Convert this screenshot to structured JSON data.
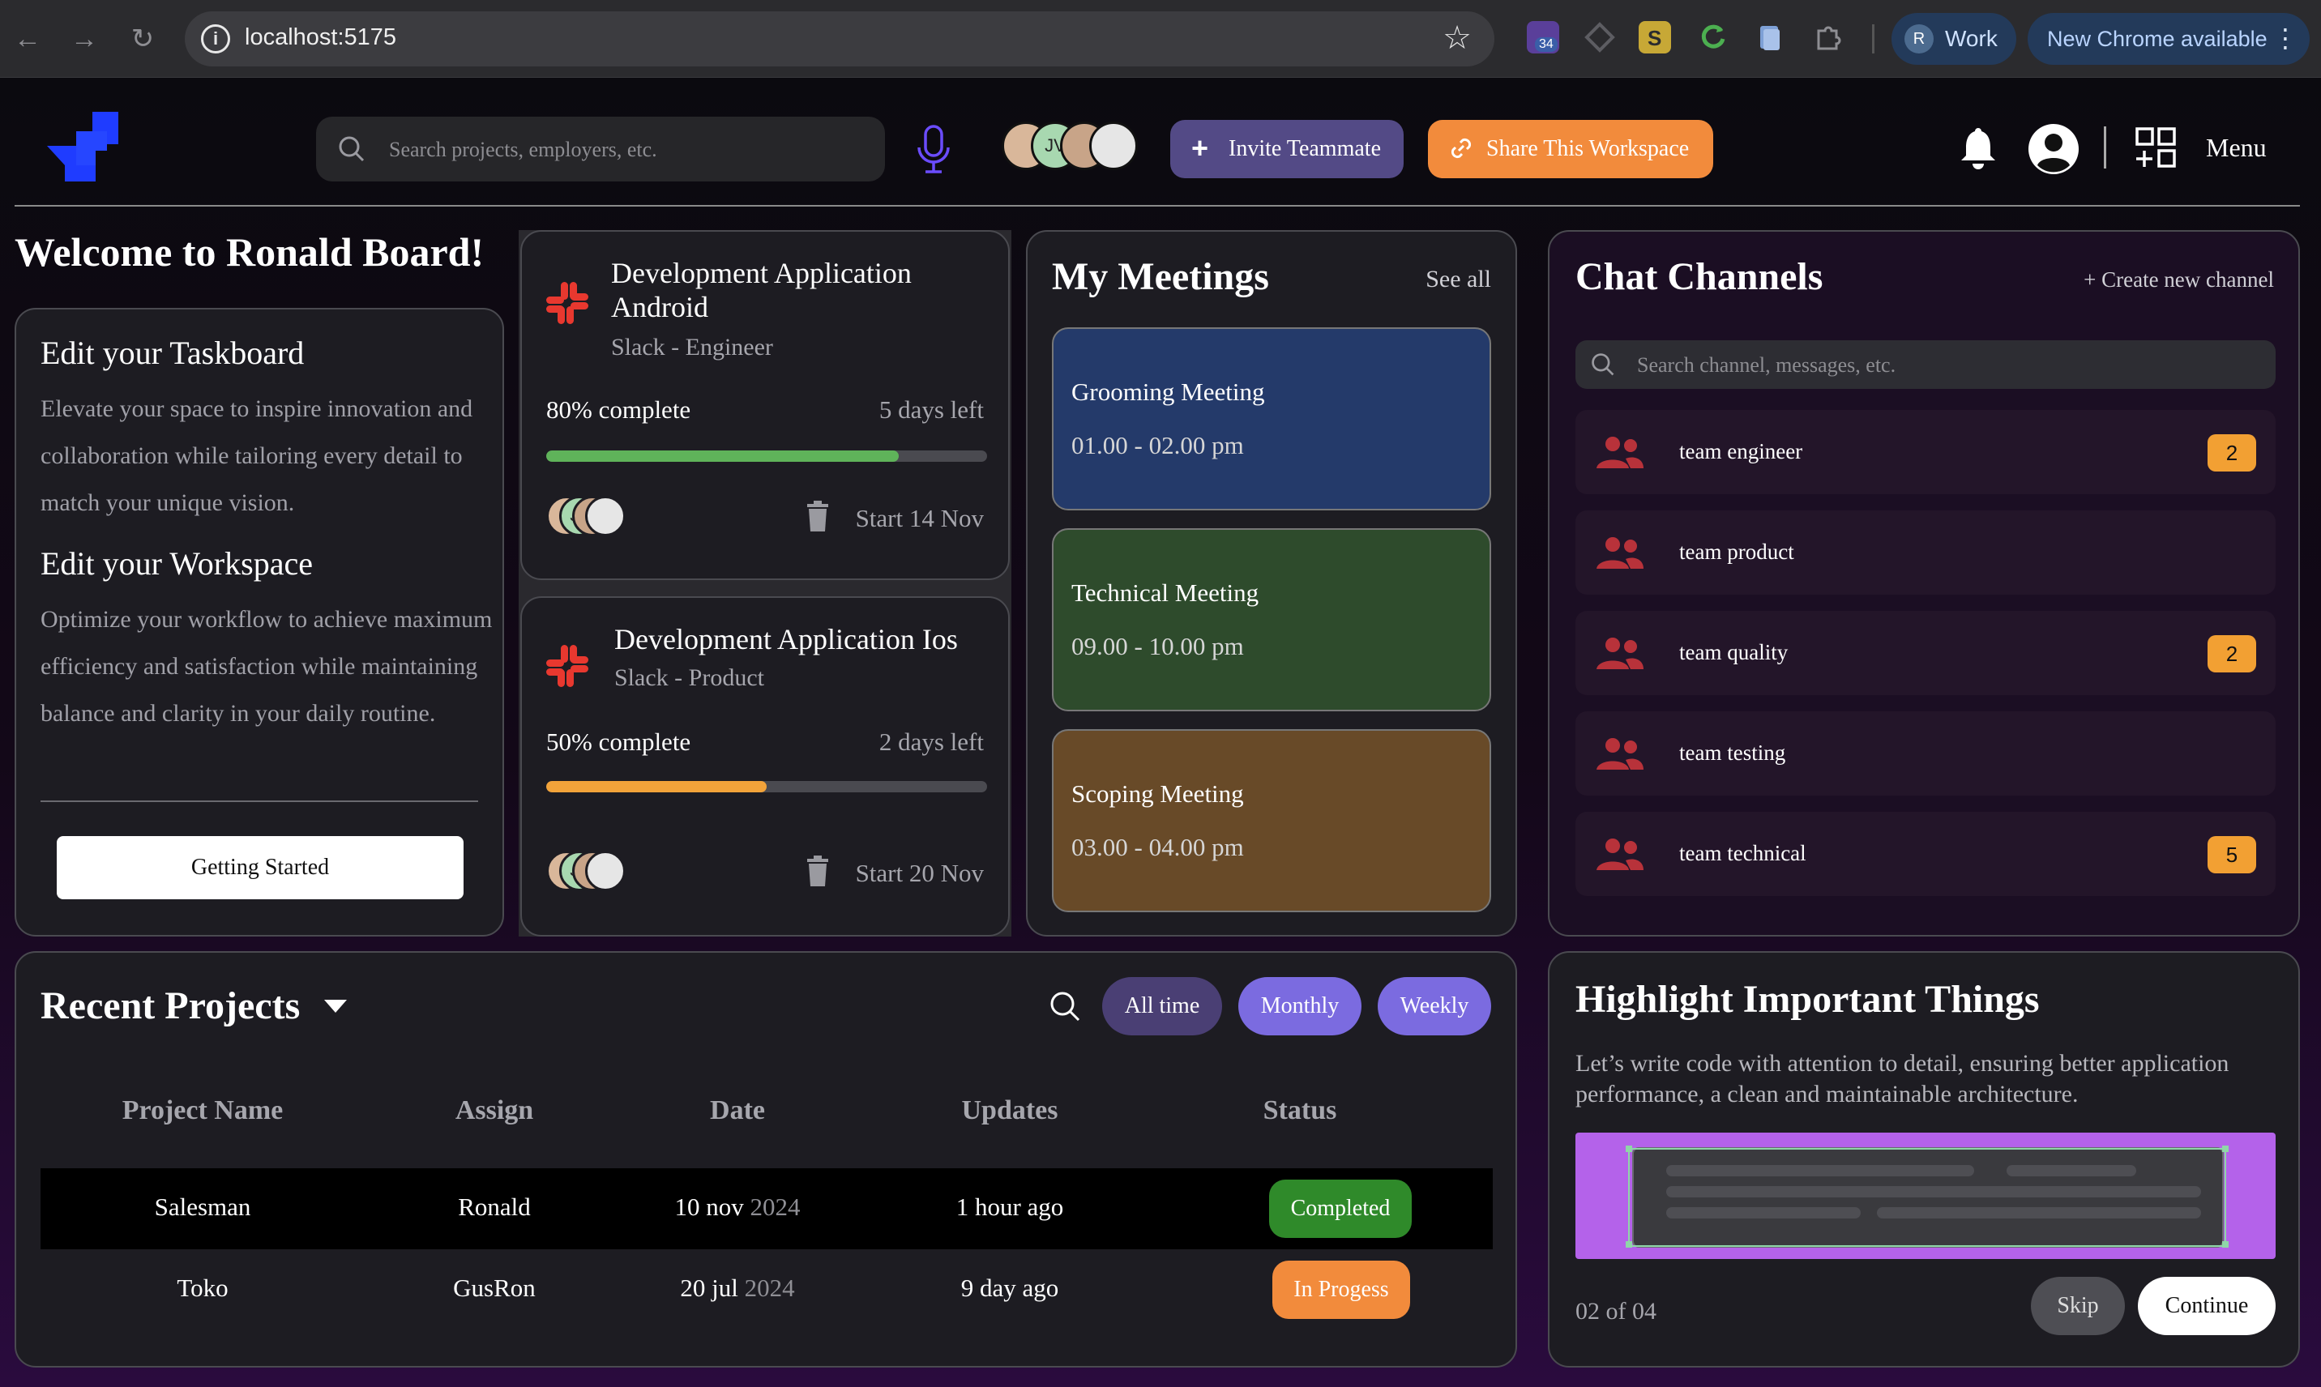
{
  "browser": {
    "url": "localhost:5175",
    "ext_badge": "34",
    "profile_initial": "R",
    "profile_label": "Work",
    "update_label": "New Chrome available"
  },
  "header": {
    "search_placeholder": "Search projects, employers, etc.",
    "avatars": [
      "",
      "JV",
      "",
      ""
    ],
    "invite_label": "Invite Teammate",
    "share_label": "Share This Workspace",
    "menu_label": "Menu"
  },
  "welcome": {
    "title": "Welcome to Ronald Board!",
    "edit_taskboard_title": "Edit your Taskboard",
    "edit_taskboard_text": "Elevate your space to inspire innovation and collaboration while tailoring every detail to match your unique vision.",
    "edit_workspace_title": "Edit your Workspace",
    "edit_workspace_text": "Optimize your workflow to achieve maximum efficiency and satisfaction while maintaining balance and clarity in your daily routine.",
    "getting_started": "Getting Started"
  },
  "tasks": [
    {
      "title": "Development Application Android",
      "subtitle": "Slack - Engineer",
      "progress_label": "80% complete",
      "progress": 0.8,
      "color": "#5fb35a",
      "days_left": "5 days left",
      "start": "Start 14 Nov"
    },
    {
      "title": "Development Application Ios",
      "subtitle": "Slack - Product",
      "progress_label": "50% complete",
      "progress": 0.5,
      "color": "#f2a33a",
      "days_left": "2 days left",
      "start": "Start 20 Nov"
    }
  ],
  "meetings": {
    "title": "My Meetings",
    "see_all": "See all",
    "items": [
      {
        "name": "Grooming Meeting",
        "time": "01.00 - 02.00 pm",
        "color": "#243a6a"
      },
      {
        "name": "Technical Meeting",
        "time": "09.00 - 10.00 pm",
        "color": "#2e4b2c"
      },
      {
        "name": "Scoping Meeting",
        "time": "03.00 - 04.00 pm",
        "color": "#684a28"
      }
    ]
  },
  "chat": {
    "title": "Chat Channels",
    "create": "+ Create new channel",
    "search_placeholder": "Search channel, messages, etc.",
    "channels": [
      {
        "name": "team engineer",
        "badge": "2"
      },
      {
        "name": "team product",
        "badge": ""
      },
      {
        "name": "team quality",
        "badge": "2"
      },
      {
        "name": "team testing",
        "badge": ""
      },
      {
        "name": "team technical",
        "badge": "5"
      }
    ]
  },
  "projects": {
    "title": "Recent Projects",
    "filters": [
      "All time",
      "Monthly",
      "Weekly"
    ],
    "columns": [
      "Project Name",
      "Assign",
      "Date",
      "Updates",
      "Status"
    ],
    "rows": [
      {
        "name": "Salesman",
        "assign": "Ronald",
        "date": "10 nov",
        "year": "2024",
        "updates": "1 hour ago",
        "status": "Completed",
        "status_color": "#2f8a2a"
      },
      {
        "name": "Toko",
        "assign": "GusRon",
        "date": "20 jul",
        "year": "2024",
        "updates": "9 day ago",
        "status": "In Progess",
        "status_color": "#f28b3c"
      }
    ]
  },
  "highlight": {
    "title": "Highlight Important Things",
    "text": "Let’s write code with attention to detail, ensuring better application performance, a clean and maintainable architecture.",
    "page": "02 of 04",
    "skip": "Skip",
    "continue": "Continue"
  }
}
